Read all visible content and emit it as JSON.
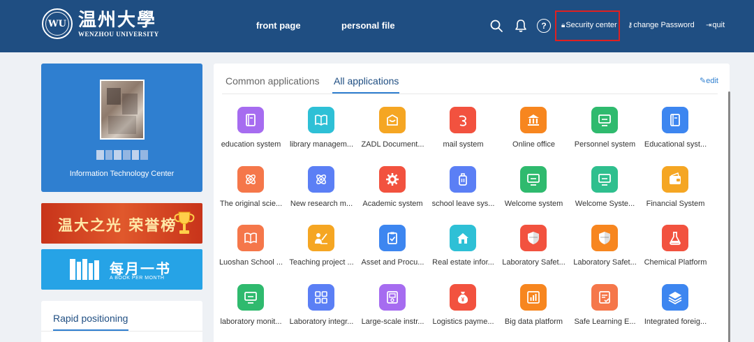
{
  "header": {
    "logo_cn": "温州大學",
    "logo_en": "WENZHOU UNIVERSITY",
    "logo_seal": "WU",
    "nav": [
      "front page",
      "personal file"
    ],
    "security_center": "Security center",
    "change_password": "change Password",
    "quit": "quit",
    "help": "?"
  },
  "profile": {
    "org": "Information Technology Center"
  },
  "banners": {
    "honor_cn": "温大之光 荣誉榜",
    "book_cn": "每月一书",
    "book_en": "A BOOK PER MONTH"
  },
  "rapid": {
    "title": "Rapid positioning"
  },
  "apps_panel": {
    "tabs": [
      "Common applications",
      "All applications"
    ],
    "active_tab": "All applications",
    "edit": "edit",
    "apps": [
      {
        "label": "education system",
        "color": "#a66cf0",
        "icon": "book-icon"
      },
      {
        "label": "library managem...",
        "color": "#2ec0d6",
        "icon": "open-book-icon"
      },
      {
        "label": "ZADL Document...",
        "color": "#f5a623",
        "icon": "document-icon"
      },
      {
        "label": "mail system",
        "color": "#f2523f",
        "icon": "mail-icon"
      },
      {
        "label": "Online office",
        "color": "#f7861f",
        "icon": "building-icon"
      },
      {
        "label": "Personnel system",
        "color": "#2fba6e",
        "icon": "monitor-icon"
      },
      {
        "label": "Educational syst...",
        "color": "#3d86f0",
        "icon": "book-icon"
      },
      {
        "label": "The original scie...",
        "color": "#f5774a",
        "icon": "atom-icon"
      },
      {
        "label": "New research m...",
        "color": "#5b7ff5",
        "icon": "atom-icon"
      },
      {
        "label": "Academic system",
        "color": "#f2523f",
        "icon": "gear-icon"
      },
      {
        "label": "school leave sys...",
        "color": "#5b7ff5",
        "icon": "bag-icon"
      },
      {
        "label": "Welcome system",
        "color": "#2fba6e",
        "icon": "monitor-icon"
      },
      {
        "label": "Welcome Syste...",
        "color": "#2fbf8e",
        "icon": "monitor-icon"
      },
      {
        "label": "Financial System",
        "color": "#f5a623",
        "icon": "wallet-icon"
      },
      {
        "label": "Luoshan School ...",
        "color": "#f5774a",
        "icon": "open-book-icon"
      },
      {
        "label": "Teaching project ...",
        "color": "#f5a623",
        "icon": "teacher-icon"
      },
      {
        "label": "Asset and Procu...",
        "color": "#3d86f0",
        "icon": "clipboard-icon"
      },
      {
        "label": "Real estate infor...",
        "color": "#2ec0d6",
        "icon": "house-icon"
      },
      {
        "label": "Laboratory Safet...",
        "color": "#f2523f",
        "icon": "shield-icon"
      },
      {
        "label": "Laboratory Safet...",
        "color": "#f7861f",
        "icon": "shield-icon"
      },
      {
        "label": "Chemical Platform",
        "color": "#f2523f",
        "icon": "flask-icon"
      },
      {
        "label": "laboratory monit...",
        "color": "#2fba6e",
        "icon": "monitor-icon"
      },
      {
        "label": "Laboratory integr...",
        "color": "#5b7ff5",
        "icon": "grid-icon"
      },
      {
        "label": "Large-scale instr...",
        "color": "#a66cf0",
        "icon": "instrument-icon"
      },
      {
        "label": "Logistics payme...",
        "color": "#f2523f",
        "icon": "money-bag-icon"
      },
      {
        "label": "Big data platform",
        "color": "#f7861f",
        "icon": "chart-icon"
      },
      {
        "label": "Safe Learning E...",
        "color": "#f5774a",
        "icon": "checklist-icon"
      },
      {
        "label": "Integrated foreig...",
        "color": "#3d86f0",
        "icon": "layers-icon"
      }
    ]
  }
}
